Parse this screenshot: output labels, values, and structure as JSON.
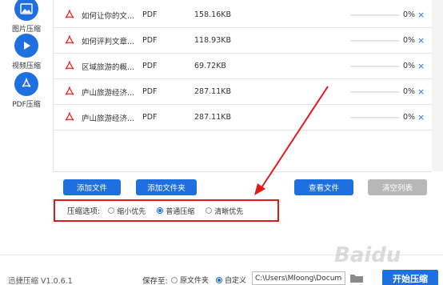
{
  "sidebar": {
    "items": [
      {
        "label": "图片压缩",
        "icon": "image-icon"
      },
      {
        "label": "视频压缩",
        "icon": "play-icon"
      },
      {
        "label": "PDF压缩",
        "icon": "pdf-icon"
      }
    ]
  },
  "files": [
    {
      "name": "如何让你的文...",
      "type": "PDF",
      "size": "158.16KB",
      "progress": "0%",
      "progress_value": 0
    },
    {
      "name": "如何评判文章...",
      "type": "PDF",
      "size": "118.93KB",
      "progress": "0%",
      "progress_value": 0
    },
    {
      "name": "区域旅游的概...",
      "type": "PDF",
      "size": "69.72KB",
      "progress": "0%",
      "progress_value": 0
    },
    {
      "name": "庐山旅游经济...",
      "type": "PDF",
      "size": "287.11KB",
      "progress": "0%",
      "progress_value": 0
    },
    {
      "name": "庐山旅游经济...",
      "type": "PDF",
      "size": "287.11KB",
      "progress": "0%",
      "progress_value": 0
    }
  ],
  "remove_symbol": "×",
  "toolbar": {
    "add_file": "添加文件",
    "add_folder": "添加文件夹",
    "view_file": "查看文件",
    "clear_list": "清空列表"
  },
  "options": {
    "label": "压缩选项:",
    "choices": [
      "缩小优先",
      "普通压缩",
      "清晰优先"
    ],
    "selected": "普通压缩"
  },
  "footer": {
    "app_name": "迅捷压缩 V1.0.6.1",
    "save_to": "保存至:",
    "save_original": "原文件夹",
    "save_custom": "自定义",
    "save_selected": "自定义",
    "path": "C:\\Users\\Mloong\\Docume",
    "start": "开始压缩"
  },
  "watermark": "Baidu",
  "colors": {
    "accent": "#1e6fe0",
    "highlight": "#e0191b",
    "pdf_red": "#e8312f"
  }
}
